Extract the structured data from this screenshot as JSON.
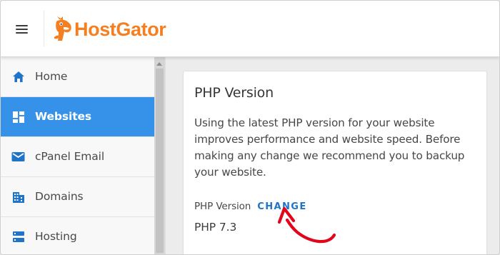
{
  "header": {
    "logo_text": "HostGator",
    "brand_color": "#f57f20"
  },
  "sidebar": {
    "items": [
      {
        "label": "Home",
        "icon": "home-icon",
        "active": false
      },
      {
        "label": "Websites",
        "icon": "dashboard-icon",
        "active": true
      },
      {
        "label": "cPanel Email",
        "icon": "mail-icon",
        "active": false
      },
      {
        "label": "Domains",
        "icon": "building-icon",
        "active": false
      },
      {
        "label": "Hosting",
        "icon": "server-icon",
        "active": false
      }
    ],
    "active_color": "#3592e8",
    "icon_color": "#1f74c9"
  },
  "card": {
    "title": "PHP Version",
    "description": "Using the latest PHP version for your website improves performance and website speed. Before making any change we recommend you to backup your website.",
    "php_label": "PHP Version",
    "change_label": "CHANGE",
    "current_version": "PHP 7.3",
    "link_color": "#1f74c9"
  },
  "annotation": {
    "arrow_color": "#e1061c"
  }
}
